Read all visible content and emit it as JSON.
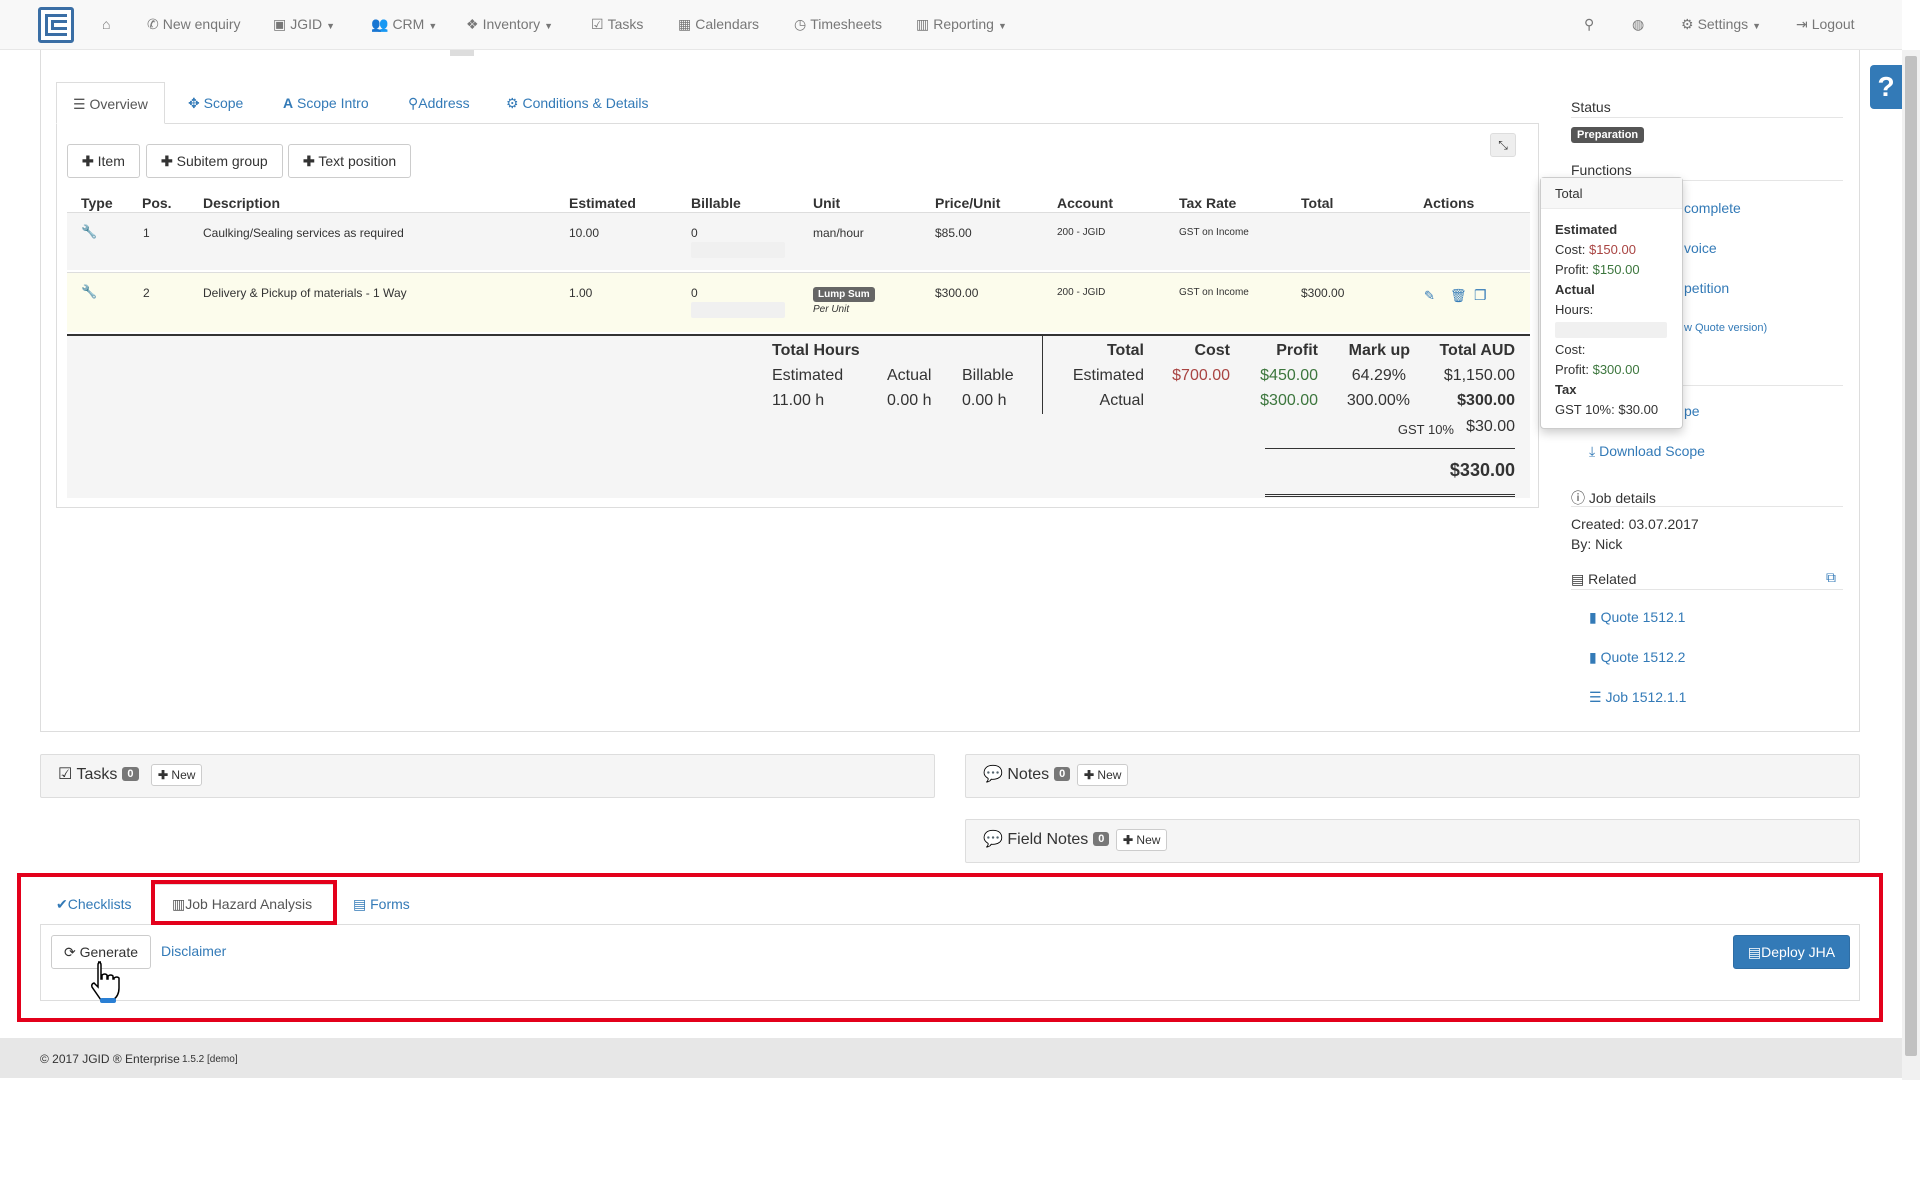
{
  "nav": {
    "items": [
      {
        "label": "New enquiry",
        "icon": "phone-icon"
      },
      {
        "label": "JGID",
        "icon": "jgid-logo-icon"
      },
      {
        "label": "CRM",
        "icon": "users-icon"
      },
      {
        "label": "Inventory",
        "icon": "cubes-icon"
      },
      {
        "label": "Tasks",
        "icon": "check-square-icon"
      },
      {
        "label": "Calendars",
        "icon": "calendar-icon"
      },
      {
        "label": "Timesheets",
        "icon": "clock-icon"
      },
      {
        "label": "Reporting",
        "icon": "bar-chart-icon"
      }
    ],
    "settings": "Settings",
    "logout": "Logout"
  },
  "tabs": {
    "overview": "Overview",
    "scope": "Scope",
    "scope_intro": "Scope Intro",
    "address": "Address",
    "conditions": "Conditions & Details"
  },
  "toolbar": {
    "item": "Item",
    "subitem_group": "Subitem group",
    "text_position": "Text position"
  },
  "table": {
    "headers": {
      "type": "Type",
      "pos": "Pos.",
      "description": "Description",
      "estimated": "Estimated",
      "billable": "Billable",
      "unit": "Unit",
      "price_unit": "Price/Unit",
      "account": "Account",
      "tax_rate": "Tax Rate",
      "total": "Total",
      "actions": "Actions"
    },
    "rows": [
      {
        "pos": "1",
        "description": "Caulking/Sealing services as required",
        "estimated": "10.00",
        "billable": "0",
        "unit": "man/hour",
        "price": "$85.00",
        "account": "200 - JGID",
        "tax": "GST on Income",
        "total": ""
      },
      {
        "pos": "2",
        "description": "Delivery & Pickup of materials - 1 Way",
        "estimated": "1.00",
        "billable": "0",
        "unit_badge": "Lump Sum",
        "unit_sub": "Per Unit",
        "price": "$300.00",
        "account": "200 - JGID",
        "tax": "GST on Income",
        "total": "$300.00"
      }
    ]
  },
  "summary": {
    "total_hours": "Total Hours",
    "estimated": "Estimated",
    "actual": "Actual",
    "billable": "Billable",
    "hours_est": "11.00 h",
    "hours_act": "0.00 h",
    "hours_bill": "0.00 h",
    "total": "Total",
    "cost": "Cost",
    "profit": "Profit",
    "markup": "Mark up",
    "total_aud": "Total AUD",
    "est_label": "Estimated",
    "est_cost": "$700.00",
    "est_profit": "$450.00",
    "est_markup": "64.29%",
    "est_total": "$1,150.00",
    "act_label": "Actual",
    "act_profit": "$300.00",
    "act_markup": "300.00%",
    "act_total": "$300.00",
    "gst_label": "GST 10%",
    "gst_value": "$30.00",
    "grand_total": "$330.00"
  },
  "popover": {
    "title": "Total",
    "estimated": "Estimated",
    "cost_label": "Cost:",
    "cost_est": "$150.00",
    "profit_label": "Profit:",
    "profit_est": "$150.00",
    "actual": "Actual",
    "hours_label": "Hours:",
    "cost_act_label": "Cost:",
    "profit_act_label": "Profit:",
    "profit_act": "$300.00",
    "tax": "Tax",
    "tax_line": "GST 10%: $30.00"
  },
  "sidebar": {
    "status_label": "Status",
    "status_value": "Preparation",
    "functions_label": "Functions",
    "func1": "complete",
    "func2": "voice",
    "func3": "petition",
    "func4": "w Quote version)",
    "func5": "pe",
    "download": "Download Scope",
    "job_details": "Job details",
    "created": "Created: 03.07.2017",
    "by": "By: Nick",
    "related": "Related",
    "related_items": [
      "Quote 1512.1",
      "Quote 1512.2",
      "Job 1512.1.1"
    ]
  },
  "panels": {
    "tasks": "Tasks",
    "tasks_count": "0",
    "notes": "Notes",
    "notes_count": "0",
    "field_notes": "Field Notes",
    "field_notes_count": "0",
    "new": "New"
  },
  "bottom": {
    "checklists": "Checklists",
    "jha": "Job Hazard Analysis",
    "forms": "Forms",
    "generate": "Generate",
    "disclaimer": "Disclaimer",
    "deploy": "Deploy JHA"
  },
  "footer": {
    "copyright": "© 2017 JGID ® Enterprise",
    "version": "1.5.2 [demo]"
  },
  "colors": {
    "primary": "#337ab7",
    "danger": "#a94442",
    "success": "#3c763d",
    "highlight": "#e3001b"
  }
}
